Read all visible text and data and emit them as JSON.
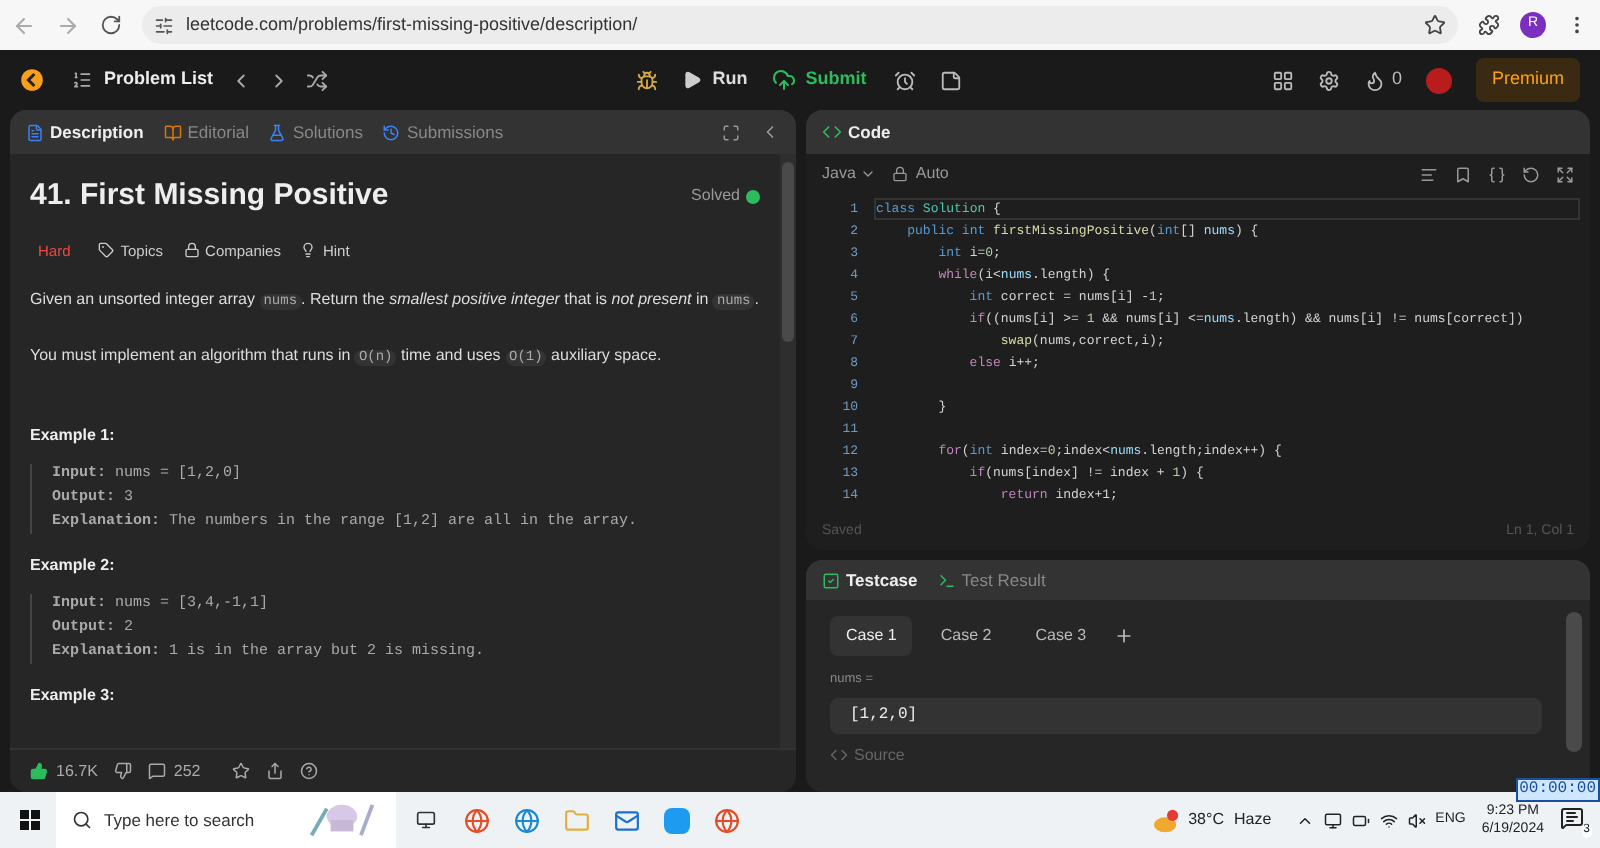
{
  "browser": {
    "url": "leetcode.com/problems/first-missing-positive/description/",
    "profile_initial": "R"
  },
  "navbar": {
    "problem_list": "Problem List",
    "run": "Run",
    "submit": "Submit",
    "streak": "0",
    "premium": "Premium"
  },
  "description_panel": {
    "tabs": [
      {
        "label": "Description",
        "selected": true
      },
      {
        "label": "Editorial",
        "selected": false
      },
      {
        "label": "Solutions",
        "selected": false
      },
      {
        "label": "Submissions",
        "selected": false
      }
    ],
    "title": "41. First Missing Positive",
    "status": "Solved",
    "difficulty": "Hard",
    "tags": [
      "Topics",
      "Companies",
      "Hint"
    ],
    "paragraphs": [
      [
        {
          "kind": "text",
          "t": "Given an unsorted integer array "
        },
        {
          "kind": "code",
          "t": "nums"
        },
        {
          "kind": "text",
          "t": ". Return the *smallest positive integer* that is *not present* in "
        },
        {
          "kind": "code",
          "t": "nums"
        },
        {
          "kind": "text",
          "t": "."
        }
      ],
      [
        {
          "kind": "text",
          "t": "You must implement an algorithm that runs in "
        },
        {
          "kind": "code",
          "t": "O(n)"
        },
        {
          "kind": "text",
          "t": " time and uses "
        },
        {
          "kind": "code",
          "t": "O(1)"
        },
        {
          "kind": "text",
          "t": " auxiliary space."
        }
      ]
    ],
    "examples": [
      {
        "heading": "Example 1:",
        "lines": [
          "**Input:** nums = [1,2,0]",
          "**Output:** 3",
          "**Explanation:** The numbers in the range [1,2] are all in the array."
        ]
      },
      {
        "heading": "Example 2:",
        "lines": [
          "**Input:** nums = [3,4,-1,1]",
          "**Output:** 2",
          "**Explanation:** 1 is in the array but 2 is missing."
        ]
      },
      {
        "heading": "Example 3:"
      }
    ],
    "footer": {
      "likes": "16.7K",
      "comments": "252"
    }
  },
  "code_panel": {
    "title": "Code",
    "language": "Java",
    "mode": "Auto",
    "status": "Saved",
    "cursor": "Ln 1, Col 1",
    "lines": [
      {
        "n": "1",
        "tokens": [
          {
            "kind": "kw",
            "text": "class"
          },
          {
            "kind": "type",
            "text": " Solution"
          },
          {
            "kind": "p",
            "text": " {"
          }
        ]
      },
      {
        "n": "2",
        "tokens": [
          {
            "kind": "kw",
            "text": "    public"
          },
          {
            "kind": "kw",
            "text": " int"
          },
          {
            "kind": "fn",
            "text": " firstMissingPositive"
          },
          {
            "kind": "p",
            "text": "("
          },
          {
            "kind": "kw",
            "text": "int"
          },
          {
            "kind": "p",
            "text": "[]"
          },
          {
            "kind": "var",
            "text": " nums"
          },
          {
            "kind": "p",
            "text": ") {"
          }
        ]
      },
      {
        "n": "3",
        "tokens": [
          {
            "kind": "kw",
            "text": "        int"
          },
          {
            "kind": "p",
            "text": " i="
          },
          {
            "kind": "num",
            "text": "0"
          },
          {
            "kind": "p",
            "text": ";"
          }
        ]
      },
      {
        "n": "4",
        "tokens": [
          {
            "kind": "ctl",
            "text": "        while"
          },
          {
            "kind": "p",
            "text": "(i<"
          },
          {
            "kind": "var",
            "text": "nums"
          },
          {
            "kind": "p",
            "text": ".length) {"
          }
        ]
      },
      {
        "n": "5",
        "tokens": [
          {
            "kind": "kw",
            "text": "            int"
          },
          {
            "kind": "p",
            "text": " correct = nums[i] -"
          },
          {
            "kind": "num",
            "text": "1"
          },
          {
            "kind": "p",
            "text": ";"
          }
        ]
      },
      {
        "n": "6",
        "tokens": [
          {
            "kind": "ctl",
            "text": "            if"
          },
          {
            "kind": "p",
            "text": "((nums[i] >= "
          },
          {
            "kind": "num",
            "text": "1"
          },
          {
            "kind": "p",
            "text": " && nums[i] <="
          },
          {
            "kind": "var",
            "text": "nums"
          },
          {
            "kind": "p",
            "text": ".length) && nums[i] != nums[correct])"
          }
        ]
      },
      {
        "n": "7",
        "tokens": [
          {
            "kind": "fn",
            "text": "                swap"
          },
          {
            "kind": "p",
            "text": "(nums,correct,i);"
          }
        ]
      },
      {
        "n": "8",
        "tokens": [
          {
            "kind": "ctl",
            "text": "            else"
          },
          {
            "kind": "p",
            "text": " i++;"
          }
        ]
      },
      {
        "n": "9"
      },
      {
        "n": "10",
        "tokens": [
          {
            "kind": "p",
            "text": "        }"
          }
        ]
      },
      {
        "n": "11"
      },
      {
        "n": "12",
        "tokens": [
          {
            "kind": "ctl",
            "text": "        for"
          },
          {
            "kind": "p",
            "text": "("
          },
          {
            "kind": "kw",
            "text": "int"
          },
          {
            "kind": "p",
            "text": " index="
          },
          {
            "kind": "num",
            "text": "0"
          },
          {
            "kind": "p",
            "text": ";index<"
          },
          {
            "kind": "var",
            "text": "nums"
          },
          {
            "kind": "p",
            "text": ".length;index++) {"
          }
        ]
      },
      {
        "n": "13",
        "tokens": [
          {
            "kind": "ctl",
            "text": "            if"
          },
          {
            "kind": "p",
            "text": "(nums[index] != index + "
          },
          {
            "kind": "num",
            "text": "1"
          },
          {
            "kind": "p",
            "text": ") {"
          }
        ]
      },
      {
        "n": "14",
        "tokens": [
          {
            "kind": "ctl",
            "text": "                return"
          },
          {
            "kind": "p",
            "text": " index+1;"
          }
        ]
      }
    ]
  },
  "testcase_panel": {
    "tabs": [
      {
        "label": "Testcase",
        "selected": true
      },
      {
        "label": "Test Result",
        "selected": false
      }
    ],
    "cases": [
      {
        "label": "Case 1",
        "selected": true
      },
      {
        "label": "Case 2",
        "selected": false
      },
      {
        "label": "Case 3",
        "selected": false
      }
    ],
    "param": "nums =",
    "value": "[1,2,0]",
    "source": "Source"
  },
  "timer": "00:00:00",
  "taskbar": {
    "search_placeholder": "Type here to search",
    "temperature": "38°C",
    "weather": "Haze",
    "language": "ENG",
    "time": "9:23 PM",
    "date": "6/19/2024",
    "notifications": "3"
  }
}
